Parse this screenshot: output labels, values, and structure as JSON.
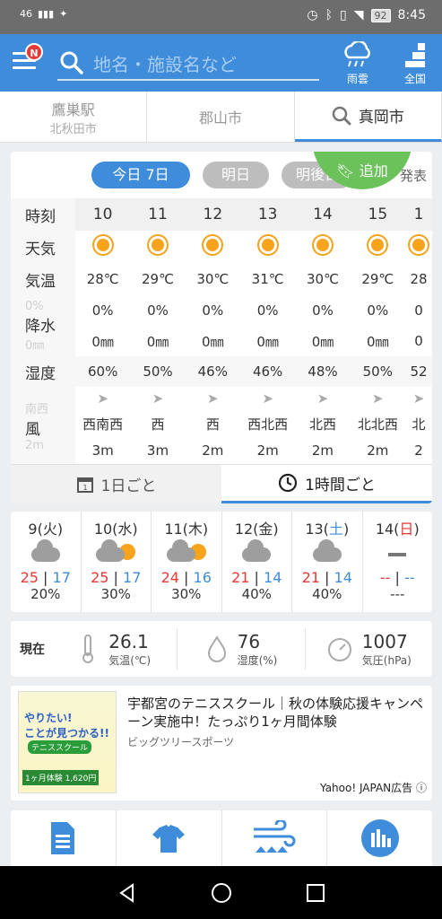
{
  "status_bar": {
    "network": "46",
    "time": "8:45",
    "battery": "92"
  },
  "header": {
    "notification_badge": "N",
    "search_placeholder": "地名・施設名など",
    "rain_cloud_label": "雨雲",
    "nationwide_label": "全国"
  },
  "locations": [
    {
      "name": "鷹巣駅",
      "sub": "北秋田市"
    },
    {
      "name": "郡山市",
      "sub": ""
    },
    {
      "name": "真岡市",
      "sub": ""
    }
  ],
  "day_tabs": {
    "today": "今日 7日",
    "tomorrow": "明日",
    "day_after": "明後日",
    "add": "追加",
    "announce": "発表"
  },
  "hourly": {
    "labels": {
      "time": "時刻",
      "weather": "天気",
      "temp": "気温",
      "precip": "降水",
      "humidity": "湿度",
      "wind": "風"
    },
    "hours": [
      "10",
      "11",
      "12",
      "13",
      "14",
      "15",
      "1"
    ],
    "temps": [
      "28℃",
      "29℃",
      "30℃",
      "31℃",
      "30℃",
      "29℃",
      "28"
    ],
    "precip_prob": [
      "0%",
      "0%",
      "0%",
      "0%",
      "0%",
      "0%",
      "0"
    ],
    "precip_amount": [
      "0㎜",
      "0㎜",
      "0㎜",
      "0㎜",
      "0㎜",
      "0㎜",
      "0"
    ],
    "humidity": [
      "60%",
      "50%",
      "46%",
      "46%",
      "48%",
      "50%",
      "52"
    ],
    "wind_dir": [
      "西南西",
      "西",
      "西",
      "西北西",
      "北西",
      "北北西",
      "北"
    ],
    "wind_speed": [
      "3m",
      "3m",
      "2m",
      "2m",
      "2m",
      "2m",
      "2"
    ],
    "ghost_precip_prob": "0%",
    "ghost_precip_amount": "0㎜",
    "ghost_wind_dir": "南西",
    "ghost_wind_speed": "2m"
  },
  "mode_tabs": {
    "daily": "1日ごと",
    "hourly": "1時間ごと"
  },
  "weekly": [
    {
      "date": "9(火)",
      "hi": "25",
      "lo": "17",
      "pop": "20%",
      "icon": "cloud-icon"
    },
    {
      "date": "10(水)",
      "hi": "25",
      "lo": "17",
      "pop": "30%",
      "icon": "cloud-sun-icon"
    },
    {
      "date": "11(木)",
      "hi": "24",
      "lo": "16",
      "pop": "30%",
      "icon": "cloud-sun-icon"
    },
    {
      "date": "12(金)",
      "hi": "21",
      "lo": "14",
      "pop": "40%",
      "icon": "cloud-icon"
    },
    {
      "date": "13(",
      "date_day": "土",
      "date_end": ")",
      "hi": "21",
      "lo": "14",
      "pop": "40%",
      "icon": "cloud-icon"
    },
    {
      "date": "14(",
      "date_day": "日",
      "date_end": ")",
      "hi": "--",
      "lo": "--",
      "pop": "---",
      "icon": "dash-icon"
    }
  ],
  "current": {
    "label": "現在",
    "temp": "26.1",
    "temp_unit": "気温(℃)",
    "humidity": "76",
    "humidity_unit": "湿度(%)",
    "pressure": "1007",
    "pressure_unit": "気圧(hPa)"
  },
  "ad": {
    "title": "宇都宮のテニススクール｜秋の体験応援キャンペーン実施中！たっぷり1ヶ月間体験",
    "sponsor": "ビッグツリースポーツ",
    "label": "Yahoo! JAPAN広告",
    "img_text1": "やりたい!",
    "img_text2": "ことが見つかる!!",
    "img_text3": "テニススクール",
    "img_text4": "1ヶ月体験 1,620円"
  },
  "colors": {
    "accent": "#3f8cdb",
    "add_green": "#6cc25a",
    "hi": "#e53935",
    "lo": "#3f8cdb"
  }
}
